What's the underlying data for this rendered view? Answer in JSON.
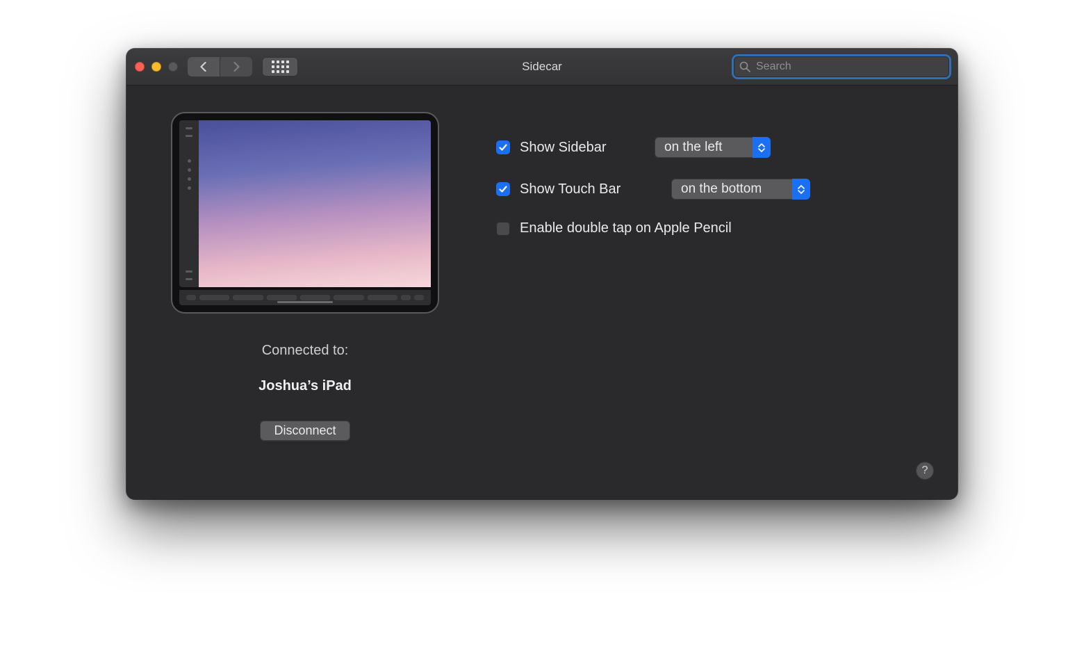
{
  "window": {
    "title": "Sidecar"
  },
  "toolbar": {
    "search_placeholder": "Search"
  },
  "device": {
    "connected_label": "Connected to:",
    "name": "Joshua’s iPad",
    "disconnect_label": "Disconnect"
  },
  "options": {
    "show_sidebar": {
      "label": "Show Sidebar",
      "checked": true,
      "value": "on the left"
    },
    "show_touch_bar": {
      "label": "Show Touch Bar",
      "checked": true,
      "value": "on the bottom"
    },
    "double_tap": {
      "label": "Enable double tap on Apple Pencil",
      "checked": false
    }
  },
  "help_label": "?"
}
